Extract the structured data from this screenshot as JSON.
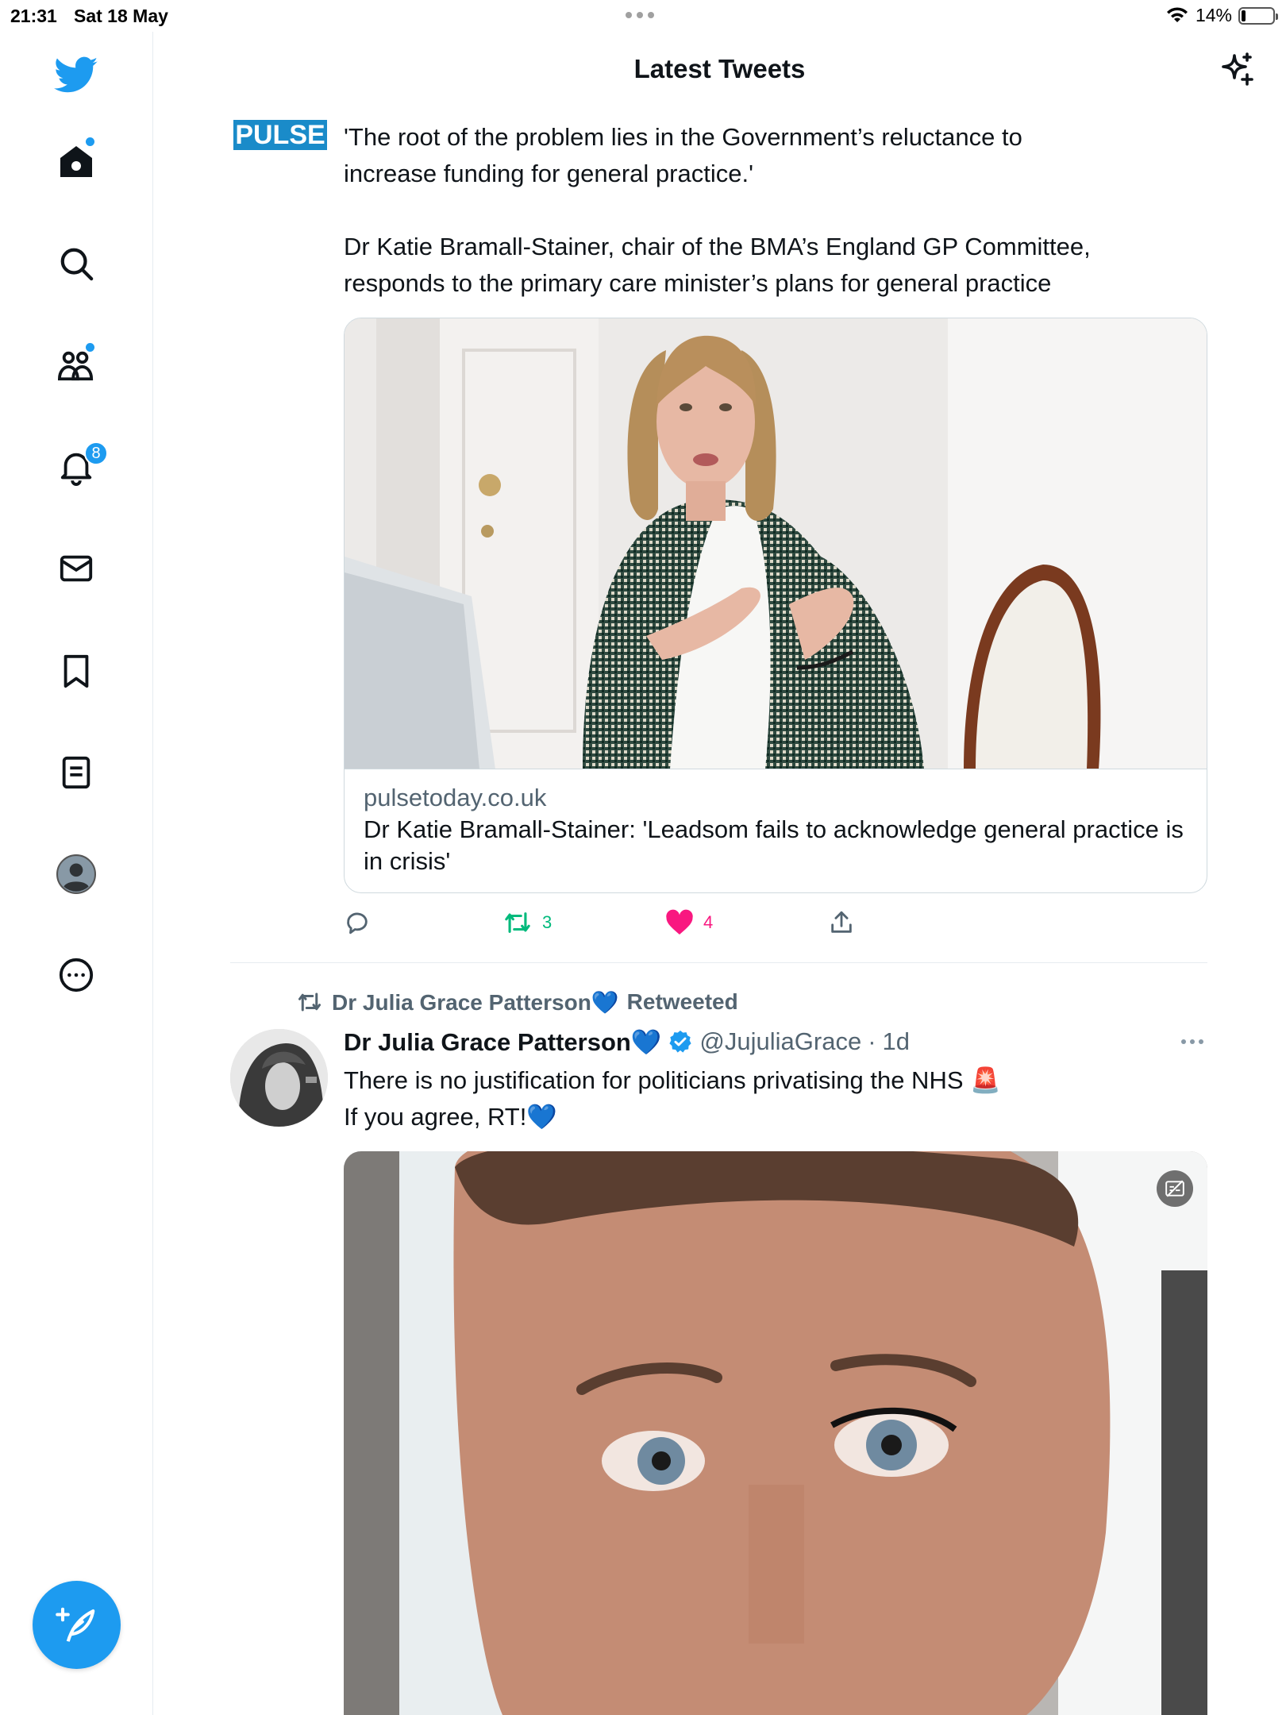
{
  "status_bar": {
    "time": "21:31",
    "date": "Sat 18 May",
    "battery": "14%"
  },
  "header": {
    "title": "Latest Tweets"
  },
  "sidebar": {
    "notifications_count": "8"
  },
  "tweet1": {
    "logo_text": "PULSE",
    "text": "'The root of the problem lies in the Government’s reluctance to\nincrease funding for general practice.'\n\nDr Katie Bramall-Stainer, chair of the BMA’s England GP Committee,\nresponds to the primary care minister’s plans for general practice",
    "card_domain": "pulsetoday.co.uk",
    "card_title": "Dr Katie Bramall-Stainer: 'Leadsom fails to acknowledge general practice is in crisis'",
    "retweets": "3",
    "likes": "4"
  },
  "tweet2": {
    "retweeted_by": "Dr Julia Grace Patterson💙",
    "retweeted_label": "Retweeted",
    "name": "Dr Julia Grace Patterson💙",
    "handle": "@JujuliaGrace",
    "separator": "·",
    "age": "1d",
    "text": "There is no justification for politicians privatising the NHS 🚨\nIf you agree, RT!💙"
  },
  "colors": {
    "accent": "#1d9bf0",
    "retweet": "#00ba7c",
    "like": "#f91880",
    "secondary_text": "#536471"
  }
}
